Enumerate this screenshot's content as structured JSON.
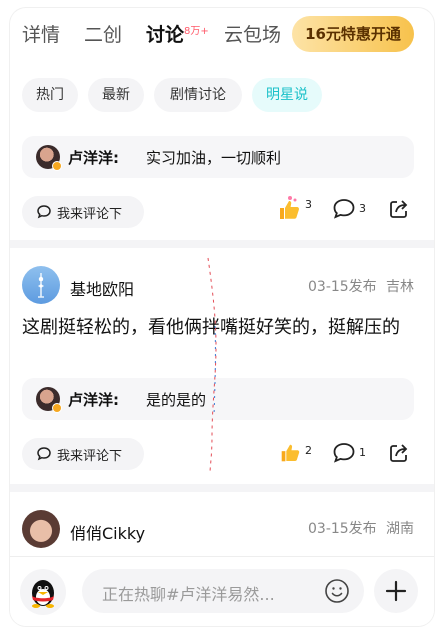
{
  "tabs": [
    {
      "label": "详情"
    },
    {
      "label": "二创"
    },
    {
      "label": "讨论",
      "badge": "8万+"
    },
    {
      "label": "云包场"
    }
  ],
  "vip_button": "16元特惠开通",
  "filters": [
    "热门",
    "最新",
    "剧情讨论",
    "明星说"
  ],
  "selected_filter": "明星说",
  "post1": {
    "reply": {
      "author": "卢洋洋:",
      "text": "实习加油，一切顺利"
    },
    "comment_button": "我来评论下",
    "likes": "3",
    "comments": "3"
  },
  "post2": {
    "user": "基地欧阳",
    "date": "03-15发布",
    "location": "吉林",
    "body": "这剧挺轻松的，看他俩拌嘴挺好笑的，挺解压的",
    "reply": {
      "author": "卢洋洋:",
      "text": "是的是的"
    },
    "comment_button": "我来评论下",
    "likes": "2",
    "comments": "1"
  },
  "post3": {
    "user": "俏俏Cikky",
    "date": "03-15发布",
    "location": "湖南"
  },
  "bottom_bar": {
    "placeholder": "正在热聊#卢洋洋易然..."
  },
  "colors": {
    "accent": "#1bc1c9",
    "vip_gradient_start": "#fde3a6",
    "vip_gradient_end": "#f7c24c",
    "badge": "#ff5a6a"
  }
}
